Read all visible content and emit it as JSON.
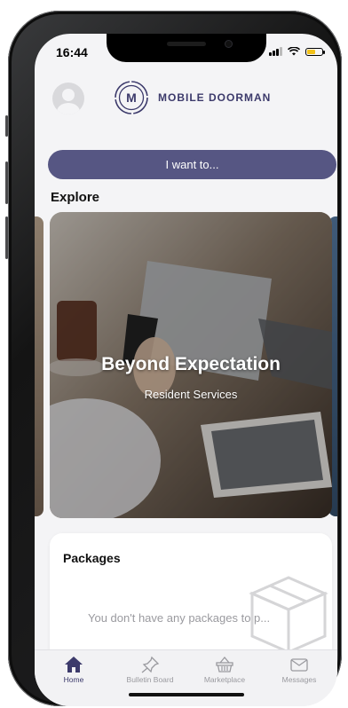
{
  "status_bar": {
    "time": "16:44",
    "battery_color": "#f2c21b"
  },
  "header": {
    "avatar_icon": "user-avatar-icon",
    "brand_mark": "M",
    "brand_name": "MOBILE DOORMAN"
  },
  "actions": {
    "want_button": "I want to..."
  },
  "explore": {
    "heading": "Explore",
    "hero": {
      "title": "Beyond Expectation",
      "subtitle": "Resident Services"
    }
  },
  "packages": {
    "title": "Packages",
    "empty_text": "You don't have any packages to p...",
    "icon": "package-box-icon"
  },
  "tabbar": {
    "items": [
      {
        "label": "Home",
        "icon": "home-icon",
        "active": true
      },
      {
        "label": "Bulletin Board",
        "icon": "pin-icon",
        "active": false
      },
      {
        "label": "Marketplace",
        "icon": "basket-icon",
        "active": false
      },
      {
        "label": "Messages",
        "icon": "envelope-icon",
        "active": false
      }
    ]
  },
  "colors": {
    "brand": "#3c3a6b",
    "button": "#565683",
    "background": "#f4f4f6"
  }
}
